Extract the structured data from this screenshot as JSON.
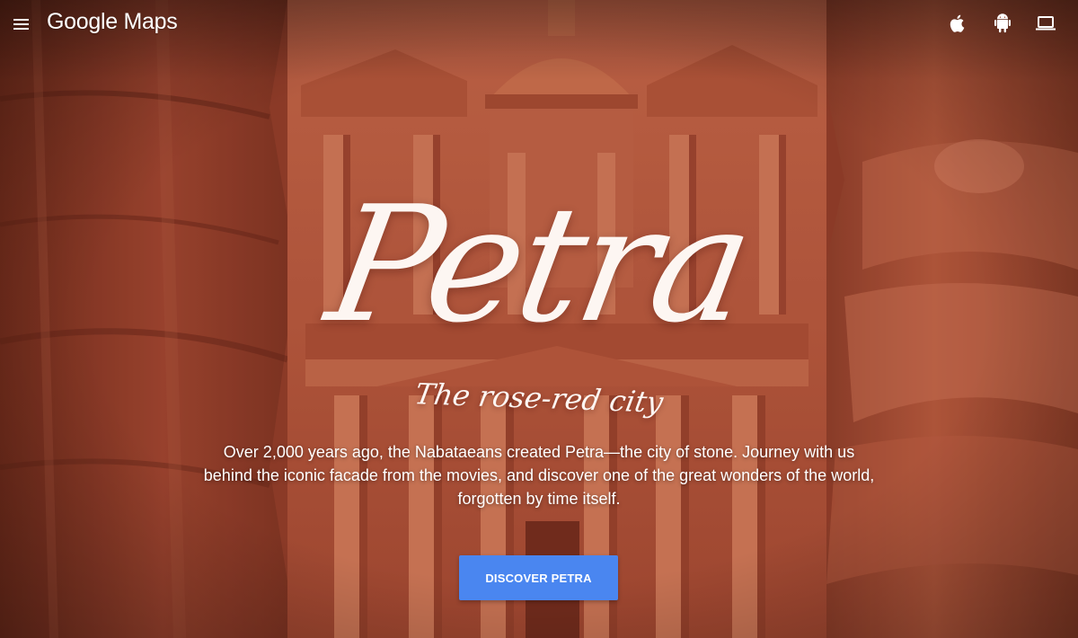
{
  "header": {
    "menu_icon": "hamburger-menu-icon",
    "brand": "Google Maps",
    "platform_icons": [
      "apple-icon",
      "android-icon",
      "laptop-icon"
    ]
  },
  "hero": {
    "title": "Petra",
    "subtitle": "The rose-red city",
    "description": "Over 2,000 years ago, the Nabataeans created Petra—the city of stone. Journey with us behind the iconic facade from the movies, and discover one of the great wonders of the world, forgotten by time itself.",
    "cta_label": "DISCOVER PETRA"
  },
  "colors": {
    "cta": "#4a86f0",
    "rock": "#a0492f",
    "text": "#ffffff"
  }
}
